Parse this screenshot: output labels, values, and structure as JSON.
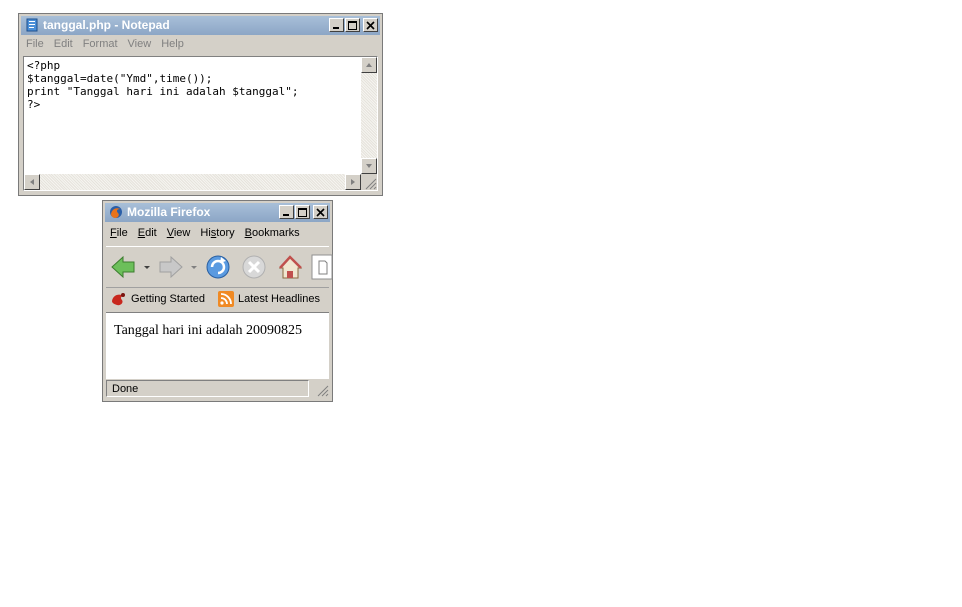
{
  "notepad": {
    "title": "tanggal.php - Notepad",
    "menu": [
      "File",
      "Edit",
      "Format",
      "View",
      "Help"
    ],
    "content": "<?php\n$tanggal=date(\"Ymd\",time());\nprint \"Tanggal hari ini adalah $tanggal\";\n?>"
  },
  "firefox": {
    "title": "Mozilla Firefox",
    "menu": [
      "File",
      "Edit",
      "View",
      "History",
      "Bookmarks"
    ],
    "menu_access_keys": [
      "F",
      "E",
      "V",
      "s",
      "B"
    ],
    "bookmarks": [
      {
        "label": "Getting Started",
        "icon": "firefox-bookmark-icon"
      },
      {
        "label": "Latest Headlines",
        "icon": "rss-feed-icon"
      }
    ],
    "page_text": "Tanggal hari ini adalah 20090825",
    "status": "Done"
  }
}
